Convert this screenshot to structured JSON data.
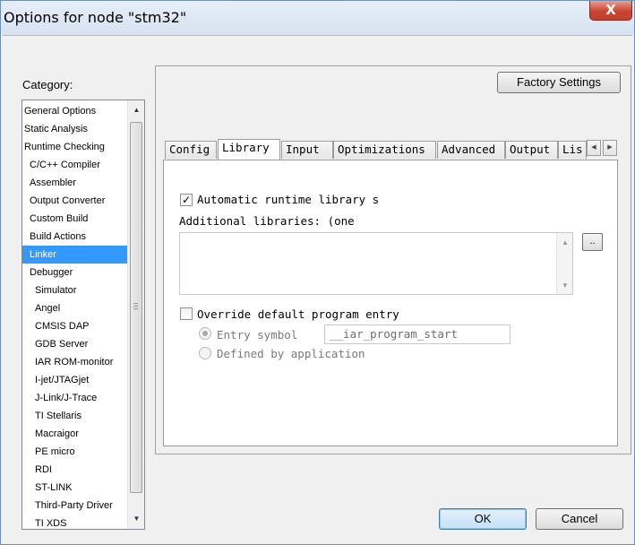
{
  "window": {
    "title": "Options for node \"stm32\"",
    "close_label": "X"
  },
  "category": {
    "label": "Category:",
    "items": [
      {
        "label": "General Options",
        "indent": 0
      },
      {
        "label": "Static Analysis",
        "indent": 0
      },
      {
        "label": "Runtime Checking",
        "indent": 0
      },
      {
        "label": "C/C++ Compiler",
        "indent": 1
      },
      {
        "label": "Assembler",
        "indent": 1
      },
      {
        "label": "Output Converter",
        "indent": 1
      },
      {
        "label": "Custom Build",
        "indent": 1
      },
      {
        "label": "Build Actions",
        "indent": 1
      },
      {
        "label": "Linker",
        "indent": 1,
        "selected": true
      },
      {
        "label": "Debugger",
        "indent": 1
      },
      {
        "label": "Simulator",
        "indent": 2
      },
      {
        "label": "Angel",
        "indent": 2
      },
      {
        "label": "CMSIS DAP",
        "indent": 2
      },
      {
        "label": "GDB Server",
        "indent": 2
      },
      {
        "label": "IAR ROM-monitor",
        "indent": 2
      },
      {
        "label": "I-jet/JTAGjet",
        "indent": 2
      },
      {
        "label": "J-Link/J-Trace",
        "indent": 2
      },
      {
        "label": "TI Stellaris",
        "indent": 2
      },
      {
        "label": "Macraigor",
        "indent": 2
      },
      {
        "label": "PE micro",
        "indent": 2
      },
      {
        "label": "RDI",
        "indent": 2
      },
      {
        "label": "ST-LINK",
        "indent": 2
      },
      {
        "label": "Third-Party Driver",
        "indent": 2
      },
      {
        "label": "TI XDS",
        "indent": 2
      }
    ]
  },
  "factory_settings_label": "Factory Settings",
  "tabs": [
    {
      "label": "Config"
    },
    {
      "label": "Library",
      "active": true
    },
    {
      "label": "Input"
    },
    {
      "label": "Optimizations"
    },
    {
      "label": "Advanced"
    },
    {
      "label": "Output"
    },
    {
      "label": "Lis"
    }
  ],
  "library_page": {
    "auto_runtime_label": "Automatic runtime library s",
    "auto_runtime_checked": true,
    "additional_libraries_label": "Additional libraries: (one",
    "browse_label": "..",
    "override_entry_label": "Override default program entry",
    "override_entry_checked": false,
    "entry_symbol_label": "Entry symbol",
    "entry_symbol_value": "__iar_program_start",
    "defined_by_app_label": "Defined by application"
  },
  "footer": {
    "ok_label": "OK",
    "cancel_label": "Cancel"
  }
}
